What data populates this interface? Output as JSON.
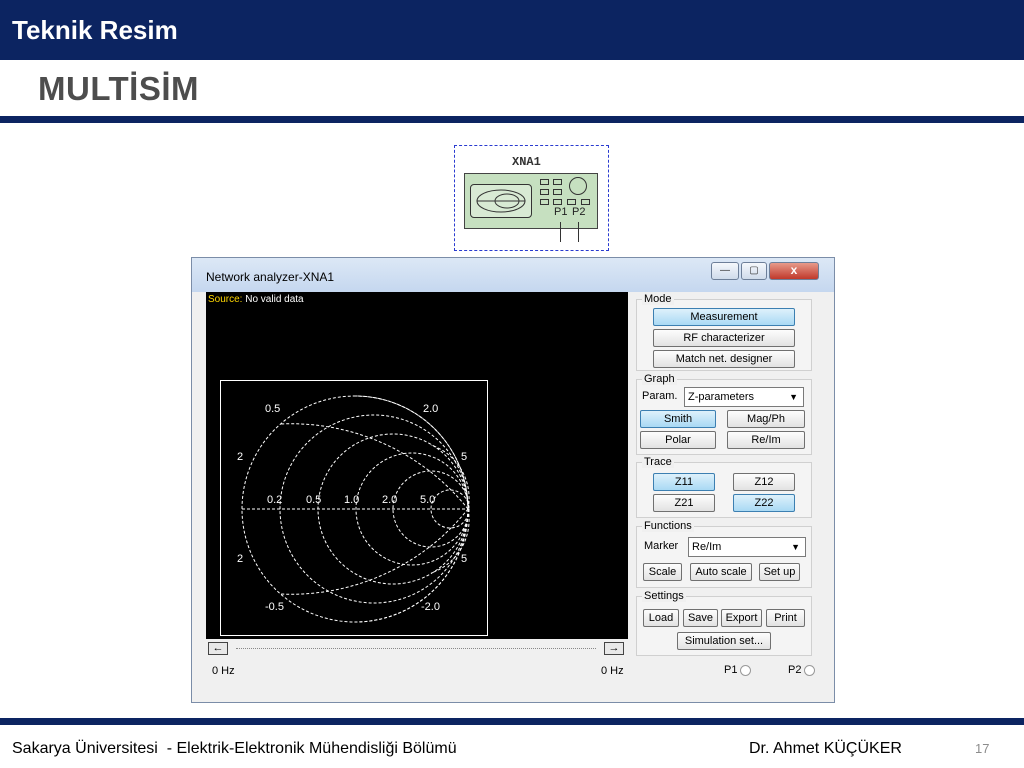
{
  "slide": {
    "header_title": "Teknik Resim",
    "subtitle": "MULTİSİM",
    "footer_left": "Sakarya Üniversitesi  - Elektrik-Elektronik Mühendisliği Bölümü",
    "footer_right": "Dr. Ahmet KÜÇÜKER",
    "page_number": "17"
  },
  "symbol": {
    "label": "XNA1",
    "port1": "P1",
    "port2": "P2"
  },
  "window": {
    "title": "Network analyzer-XNA1",
    "minimize": "—",
    "maximize": "▢",
    "close": "x",
    "source_label": "Source:",
    "source_value": "No valid data",
    "smith_labels": {
      "top_left": "0.5",
      "top_right": "2.0",
      "left_upper": "2",
      "right_upper": "5",
      "axis_02": "0.2",
      "axis_05": "0.5",
      "axis_10": "1.0",
      "axis_20": "2.0",
      "axis_50": "5.0",
      "left_lower": "2",
      "right_lower": "5",
      "bottom_left": "-0.5",
      "bottom_right": "-2.0"
    },
    "freq_left": "0 Hz",
    "freq_right": "0 Hz",
    "radio_p1": "P1",
    "radio_p2": "P2"
  },
  "panel": {
    "mode": {
      "title": "Mode",
      "measurement": "Measurement",
      "rf_characterizer": "RF characterizer",
      "match_net_designer": "Match net. designer"
    },
    "graph": {
      "title": "Graph",
      "param_label": "Param.",
      "param_value": "Z-parameters",
      "smith": "Smith",
      "mag_ph": "Mag/Ph",
      "polar": "Polar",
      "re_im": "Re/Im"
    },
    "trace": {
      "title": "Trace",
      "z11": "Z11",
      "z12": "Z12",
      "z21": "Z21",
      "z22": "Z22"
    },
    "functions": {
      "title": "Functions",
      "marker_label": "Marker",
      "marker_value": "Re/Im",
      "scale": "Scale",
      "auto_scale": "Auto scale",
      "set_up": "Set up"
    },
    "settings": {
      "title": "Settings",
      "load": "Load",
      "save": "Save",
      "export": "Export",
      "print": "Print",
      "simulation_set": "Simulation set..."
    }
  },
  "icons": {
    "left_arrow": "left-arrow-icon",
    "right_arrow": "right-arrow-icon",
    "dropdown": "chevron-down-icon"
  },
  "colors": {
    "brand_navy": "#0c2461",
    "button_active": "#a9d9f4",
    "source_label": "#ffd700"
  }
}
